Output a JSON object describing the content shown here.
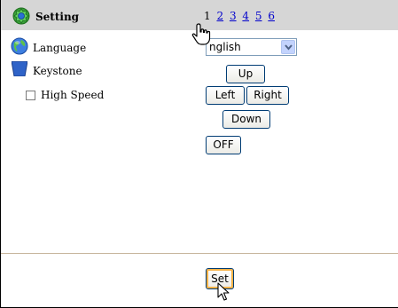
{
  "header": {
    "icon": "settings-gear-icon",
    "title": "Setting",
    "current_page": "1",
    "page_links": [
      "2",
      "3",
      "4",
      "5",
      "6"
    ],
    "background": "#d6d6d6"
  },
  "rows": {
    "language": {
      "icon": "globe-icon",
      "label": "Language"
    },
    "keystone": {
      "icon": "keystone-trapezoid-icon",
      "label": "Keystone"
    },
    "high_speed": {
      "label": "High Speed",
      "checked": false
    }
  },
  "controls": {
    "language_select": {
      "value": "nglish",
      "arrow_icon": "chevron-down-icon"
    },
    "up_label": "Up",
    "left_label": "Left",
    "right_label": "Right",
    "down_label": "Down",
    "off_label": "OFF",
    "set_label": "Set"
  },
  "cursors": {
    "hand": "hand-pointer-icon",
    "arrow": "arrow-pointer-icon"
  },
  "colors": {
    "link": "#0000cc",
    "button_border": "#003c74",
    "divider": "#c7b59d",
    "focus_ring": "#f8b348"
  }
}
